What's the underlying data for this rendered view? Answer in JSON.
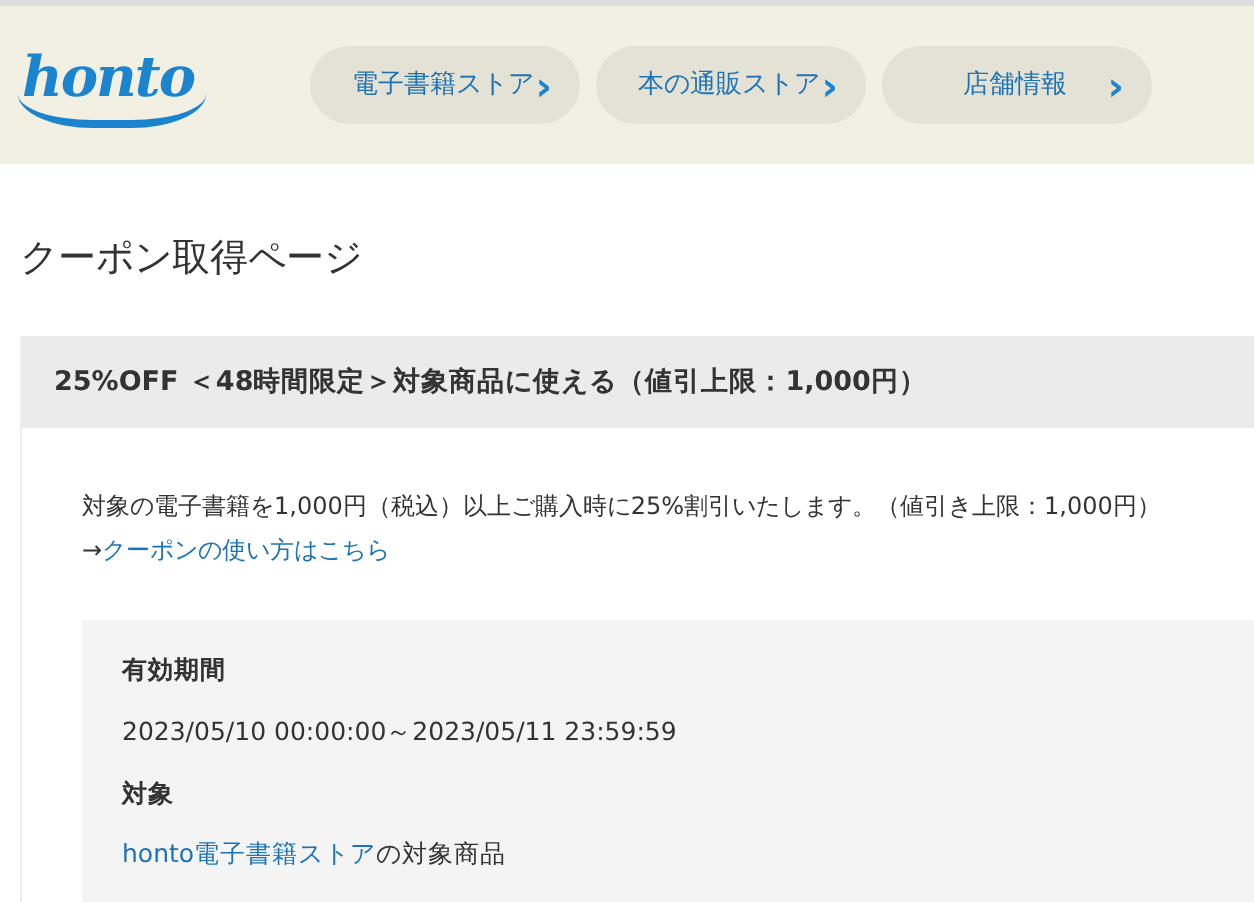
{
  "header": {
    "logo": "honto",
    "nav": [
      {
        "label": "電子書籍ストア",
        "chevron": "›"
      },
      {
        "label": "本の通販ストア",
        "chevron": "›"
      },
      {
        "label": "店舗情報",
        "chevron": "›"
      }
    ]
  },
  "page_title": "クーポン取得ページ",
  "coupon": {
    "title": "25%OFF ＜48時間限定＞対象商品に使える（値引上限：1,000円）",
    "description": "対象の電子書籍を1,000円（税込）以上ご購入時に25%割引いたします。（値引き上限：1,000円）",
    "usage_link": {
      "arrow": "→",
      "text": "クーポンの使い方はこちら"
    },
    "details": [
      {
        "label": "有効期間",
        "value": "2023/05/10 00:00:00～2023/05/11 23:59:59"
      },
      {
        "label": "対象",
        "link": "honto電子書籍ストア",
        "value": "の対象商品"
      }
    ]
  }
}
